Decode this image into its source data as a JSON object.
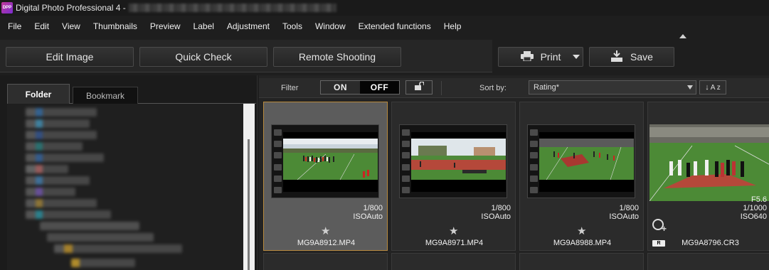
{
  "window": {
    "title": "Digital Photo Professional 4 -",
    "app_icon": "DPP"
  },
  "menu": [
    "File",
    "Edit",
    "View",
    "Thumbnails",
    "Preview",
    "Label",
    "Adjustment",
    "Tools",
    "Window",
    "Extended functions",
    "Help"
  ],
  "toolbar": {
    "edit_image": "Edit Image",
    "quick_check": "Quick Check",
    "remote_shooting": "Remote Shooting",
    "print": "Print",
    "save": "Save"
  },
  "leftpanel": {
    "tabs": [
      {
        "label": "Folder",
        "active": true
      },
      {
        "label": "Bookmark",
        "active": false
      }
    ]
  },
  "filterbar": {
    "filter_label": "Filter",
    "on": "ON",
    "off": "OFF",
    "sort_label": "Sort by:",
    "sort_value": "Rating*",
    "az_label": "A z"
  },
  "thumbnails": [
    {
      "filename": "MG9A8912.MP4",
      "shutter": "1/800",
      "iso": "ISOAuto",
      "selected": true,
      "rating_icon": "star-icon"
    },
    {
      "filename": "MG9A8971.MP4",
      "shutter": "1/800",
      "iso": "ISOAuto",
      "selected": false,
      "rating_icon": "star-icon"
    },
    {
      "filename": "MG9A8988.MP4",
      "shutter": "1/800",
      "iso": "ISOAuto",
      "selected": false,
      "rating_icon": "star-icon"
    },
    {
      "filename": "MG9A8796.CR3",
      "aperture": "F5.6",
      "shutter": "1/1000",
      "iso": "ISO640",
      "selected": false,
      "raw_badge": "R"
    }
  ],
  "colors": {
    "accent": "#b88a3e",
    "background": "#1e1e1e",
    "field": "#3f7a2a",
    "track": "#b5483a"
  }
}
